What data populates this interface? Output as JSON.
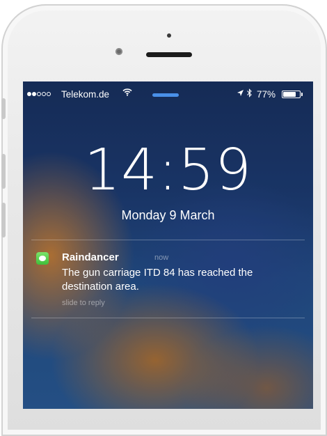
{
  "status_bar": {
    "signal_dots": [
      true,
      true,
      false,
      false,
      false
    ],
    "carrier": "Telekom.de",
    "wifi_icon": "wifi-icon",
    "location_icon": "location-arrow-icon",
    "bluetooth_icon": "bluetooth-icon",
    "battery_percent": "77%",
    "battery_level": 0.77
  },
  "lock_screen": {
    "time": "14:59",
    "date": "Monday 9 March"
  },
  "notification": {
    "app_icon": "messages-icon",
    "app_name": "Raindancer",
    "time_ago": "now",
    "message": "The gun carriage ITD 84 has reached the destination area.",
    "action_hint": "slide to reply"
  },
  "colors": {
    "lock_accent": "#4a90e8",
    "app_icon_green": "#4cd964"
  }
}
